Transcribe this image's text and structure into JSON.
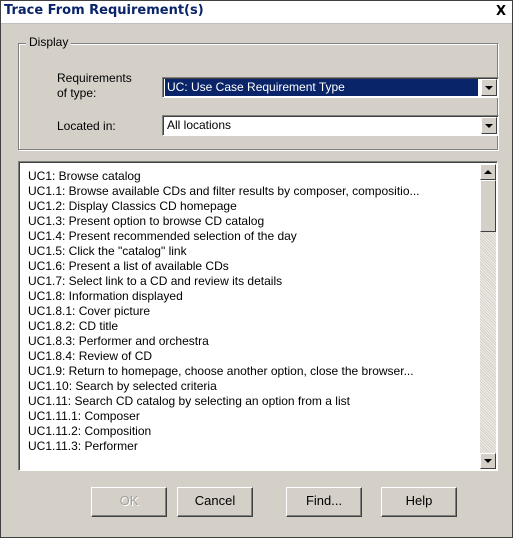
{
  "window": {
    "title": "Trace From Requirement(s)",
    "close_glyph": "X"
  },
  "display_group": {
    "legend": "Display",
    "requirements_label_line1": "Requirements",
    "requirements_label_line2": "of type:",
    "requirements_value": "UC: Use Case Requirement Type",
    "located_label": "Located in:",
    "located_value": "All locations"
  },
  "requirements_list": [
    "UC1: Browse catalog",
    "UC1.1: Browse available CDs and filter results by composer, compositio...",
    "UC1.2: Display Classics CD homepage",
    "UC1.3: Present option to browse CD catalog",
    "UC1.4: Present recommended selection of the day",
    "UC1.5: Click the \"catalog\" link",
    "UC1.6: Present a list of available CDs",
    "UC1.7: Select link to a CD and review its details",
    "UC1.8: Information displayed",
    "UC1.8.1: Cover picture",
    "UC1.8.2: CD title",
    "UC1.8.3: Performer and orchestra",
    "UC1.8.4: Review of CD",
    "UC1.9: Return to homepage, choose another option, close the browser...",
    "UC1.10: Search by selected criteria",
    "UC1.11: Search CD catalog by selecting an option from a list",
    "UC1.11.1: Composer",
    "UC1.11.2: Composition",
    "UC1.11.3: Performer"
  ],
  "buttons": {
    "ok": "OK",
    "cancel": "Cancel",
    "find": "Find...",
    "help": "Help"
  },
  "icons": {
    "close": "close-icon",
    "dropdown": "chevron-down-icon",
    "scroll_up": "scroll-up-arrow-icon",
    "scroll_down": "scroll-down-arrow-icon"
  },
  "colors": {
    "dialog_bg": "#d4d0c8",
    "title_text": "#0a246a",
    "selection_bg": "#0a246a",
    "disabled_text": "#a0a0a0"
  }
}
